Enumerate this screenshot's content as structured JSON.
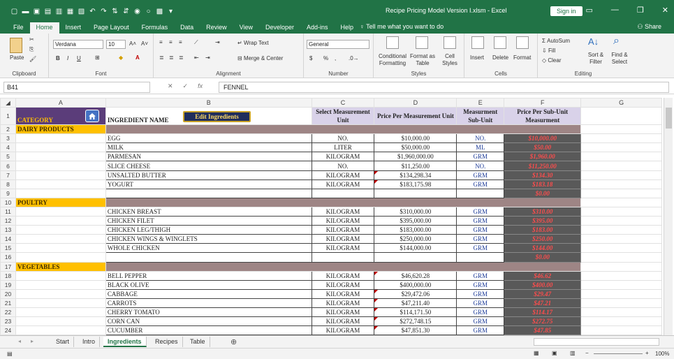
{
  "window": {
    "title": "Recipe Pricing Model Version I.xlsm  -  Excel",
    "signin_label": "Sign in"
  },
  "ribbon_tabs": [
    "File",
    "Home",
    "Insert",
    "Page Layout",
    "Formulas",
    "Data",
    "Review",
    "View",
    "Developer",
    "Add-ins",
    "Help"
  ],
  "tell_me": "Tell me what you want to do",
  "share_label": "Share",
  "ribbon": {
    "clipboard": {
      "label": "Clipboard",
      "paste": "Paste"
    },
    "font": {
      "label": "Font",
      "name": "Verdana",
      "size": "10",
      "bold": "B",
      "italic": "I",
      "underline": "U"
    },
    "alignment": {
      "label": "Alignment",
      "wrap": "Wrap Text",
      "merge": "Merge & Center"
    },
    "number": {
      "label": "Number",
      "format": "General",
      "currency": "$",
      "percent": "%",
      "comma": ","
    },
    "styles": {
      "label": "Styles",
      "cond": "Conditional Formatting",
      "table": "Format as Table",
      "cell": "Cell Styles"
    },
    "cells": {
      "label": "Cells",
      "insert": "Insert",
      "delete": "Delete",
      "format": "Format"
    },
    "editing": {
      "label": "Editing",
      "autosum": "AutoSum",
      "fill": "Fill",
      "clear": "Clear",
      "sort": "Sort & Filter",
      "find": "Find & Select"
    }
  },
  "formula_bar": {
    "name_box": "B41",
    "fx": "fx",
    "value": "FENNEL"
  },
  "columns": [
    "A",
    "B",
    "C",
    "D",
    "E",
    "F",
    "G"
  ],
  "header": {
    "category": "CATEGORY",
    "ingredient": "INGREDIENT NAME",
    "edit_button": "Edit Ingredients",
    "measure": "Select Measurement Unit",
    "price": "Price Per Measurement Unit",
    "subunit": "Measurment Sub-Unit",
    "price_sub": "Price Per Sub-Unit Measurment"
  },
  "rows": [
    {
      "n": "2",
      "type": "section",
      "name": "DAIRY PRODUCTS"
    },
    {
      "n": "3",
      "type": "item",
      "ing": "EGG",
      "unit": "NO.",
      "price": "$10,000.00",
      "sub": "NO.",
      "psub": "$10,000.00"
    },
    {
      "n": "4",
      "type": "item",
      "ing": "MILK",
      "unit": "LITER",
      "price": "$50,000.00",
      "sub": "ML",
      "psub": "$50.00"
    },
    {
      "n": "5",
      "type": "item",
      "ing": "PARMESAN",
      "unit": "KILOGRAM",
      "price": "$1,960,000.00",
      "sub": "GRM",
      "psub": "$1,960.00"
    },
    {
      "n": "6",
      "type": "item",
      "ing": "SLICE CHEESE",
      "unit": "NO.",
      "price": "$11,250.00",
      "sub": "NO.",
      "psub": "$11,250.00"
    },
    {
      "n": "7",
      "type": "item",
      "ing": "UNSALTED BUTTER",
      "unit": "KILOGRAM",
      "price": "$134,298.34",
      "sub": "GRM",
      "psub": "$134.30",
      "flag": true
    },
    {
      "n": "8",
      "type": "item",
      "ing": "YOGURT",
      "unit": "KILOGRAM",
      "price": "$183,175.98",
      "sub": "GRM",
      "psub": "$183.18",
      "flag": true
    },
    {
      "n": "9",
      "type": "item",
      "ing": "",
      "unit": "",
      "price": "",
      "sub": "",
      "psub": "$0.00"
    },
    {
      "n": "10",
      "type": "section",
      "name": "POULTRY"
    },
    {
      "n": "11",
      "type": "item",
      "ing": "CHICKEN BREAST",
      "unit": "KILOGRAM",
      "price": "$310,000.00",
      "sub": "GRM",
      "psub": "$310.00"
    },
    {
      "n": "12",
      "type": "item",
      "ing": "CHICKEN FILET",
      "unit": "KILOGRAM",
      "price": "$395,000.00",
      "sub": "GRM",
      "psub": "$395.00"
    },
    {
      "n": "13",
      "type": "item",
      "ing": "CHICKEN LEG/THIGH",
      "unit": "KILOGRAM",
      "price": "$183,000.00",
      "sub": "GRM",
      "psub": "$183.00"
    },
    {
      "n": "14",
      "type": "item",
      "ing": "CHICKEN WINGS & WINGLETS",
      "unit": "KILOGRAM",
      "price": "$250,000.00",
      "sub": "GRM",
      "psub": "$250.00"
    },
    {
      "n": "15",
      "type": "item",
      "ing": "WHOLE CHICKEN",
      "unit": "KILOGRAM",
      "price": "$144,000.00",
      "sub": "GRM",
      "psub": "$144.00"
    },
    {
      "n": "16",
      "type": "item",
      "ing": "",
      "unit": "",
      "price": "",
      "sub": "",
      "psub": "$0.00"
    },
    {
      "n": "17",
      "type": "section",
      "name": "VEGETABLES"
    },
    {
      "n": "18",
      "type": "item",
      "ing": "BELL PEPPER",
      "unit": "KILOGRAM",
      "price": "$46,620.28",
      "sub": "GRM",
      "psub": "$46.62",
      "flag": true
    },
    {
      "n": "19",
      "type": "item",
      "ing": "BLACK OLIVE",
      "unit": "KILOGRAM",
      "price": "$400,000.00",
      "sub": "GRM",
      "psub": "$400.00"
    },
    {
      "n": "20",
      "type": "item",
      "ing": "CABBAGE",
      "unit": "KILOGRAM",
      "price": "$29,472.06",
      "sub": "GRM",
      "psub": "$29.47",
      "flag": true
    },
    {
      "n": "21",
      "type": "item",
      "ing": "CARROTS",
      "unit": "KILOGRAM",
      "price": "$47,211.40",
      "sub": "GRM",
      "psub": "$47.21",
      "flag": true
    },
    {
      "n": "22",
      "type": "item",
      "ing": "CHERRY TOMATO",
      "unit": "KILOGRAM",
      "price": "$114,171.50",
      "sub": "GRM",
      "psub": "$114.17",
      "flag": true
    },
    {
      "n": "23",
      "type": "item",
      "ing": "CORN CAN",
      "unit": "KILOGRAM",
      "price": "$272,748.15",
      "sub": "GRM",
      "psub": "$272.75",
      "flag": true
    },
    {
      "n": "24",
      "type": "item",
      "ing": "CUCUMBER",
      "unit": "KILOGRAM",
      "price": "$47,851.30",
      "sub": "GRM",
      "psub": "$47.85",
      "flag": true
    }
  ],
  "sheet_tabs": [
    {
      "label": "Start",
      "active": false
    },
    {
      "label": "Intro",
      "active": false
    },
    {
      "label": "Ingredients",
      "active": true
    },
    {
      "label": "Recipes",
      "active": false
    },
    {
      "label": "Table",
      "active": false
    }
  ],
  "status": {
    "zoom": "100%"
  },
  "colors": {
    "excel_green": "#217346",
    "category_purple": "#5b3d7a",
    "section_gold": "#ffc000",
    "price_red": "#ff4c4c"
  }
}
